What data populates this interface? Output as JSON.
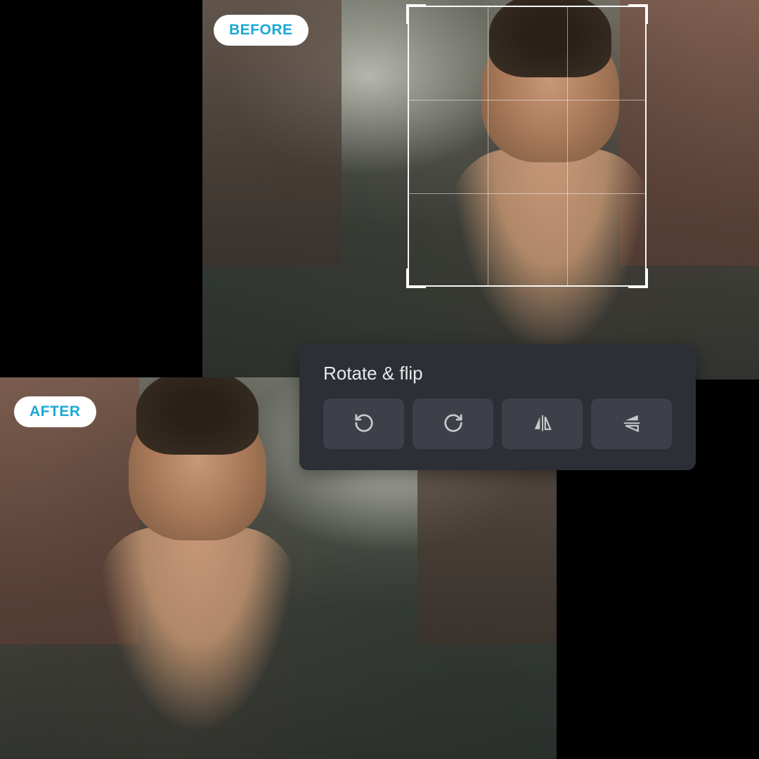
{
  "badges": {
    "before": "BEFORE",
    "after": "AFTER"
  },
  "rotate_panel": {
    "title": "Rotate & flip",
    "buttons": {
      "rotate_left": "rotate-left",
      "rotate_right": "rotate-right",
      "flip_horizontal": "flip-horizontal",
      "flip_vertical": "flip-vertical"
    }
  },
  "colors": {
    "badge_text": "#1ba8d4",
    "panel_bg": "#2c2f36",
    "button_bg": "#3d4048"
  }
}
